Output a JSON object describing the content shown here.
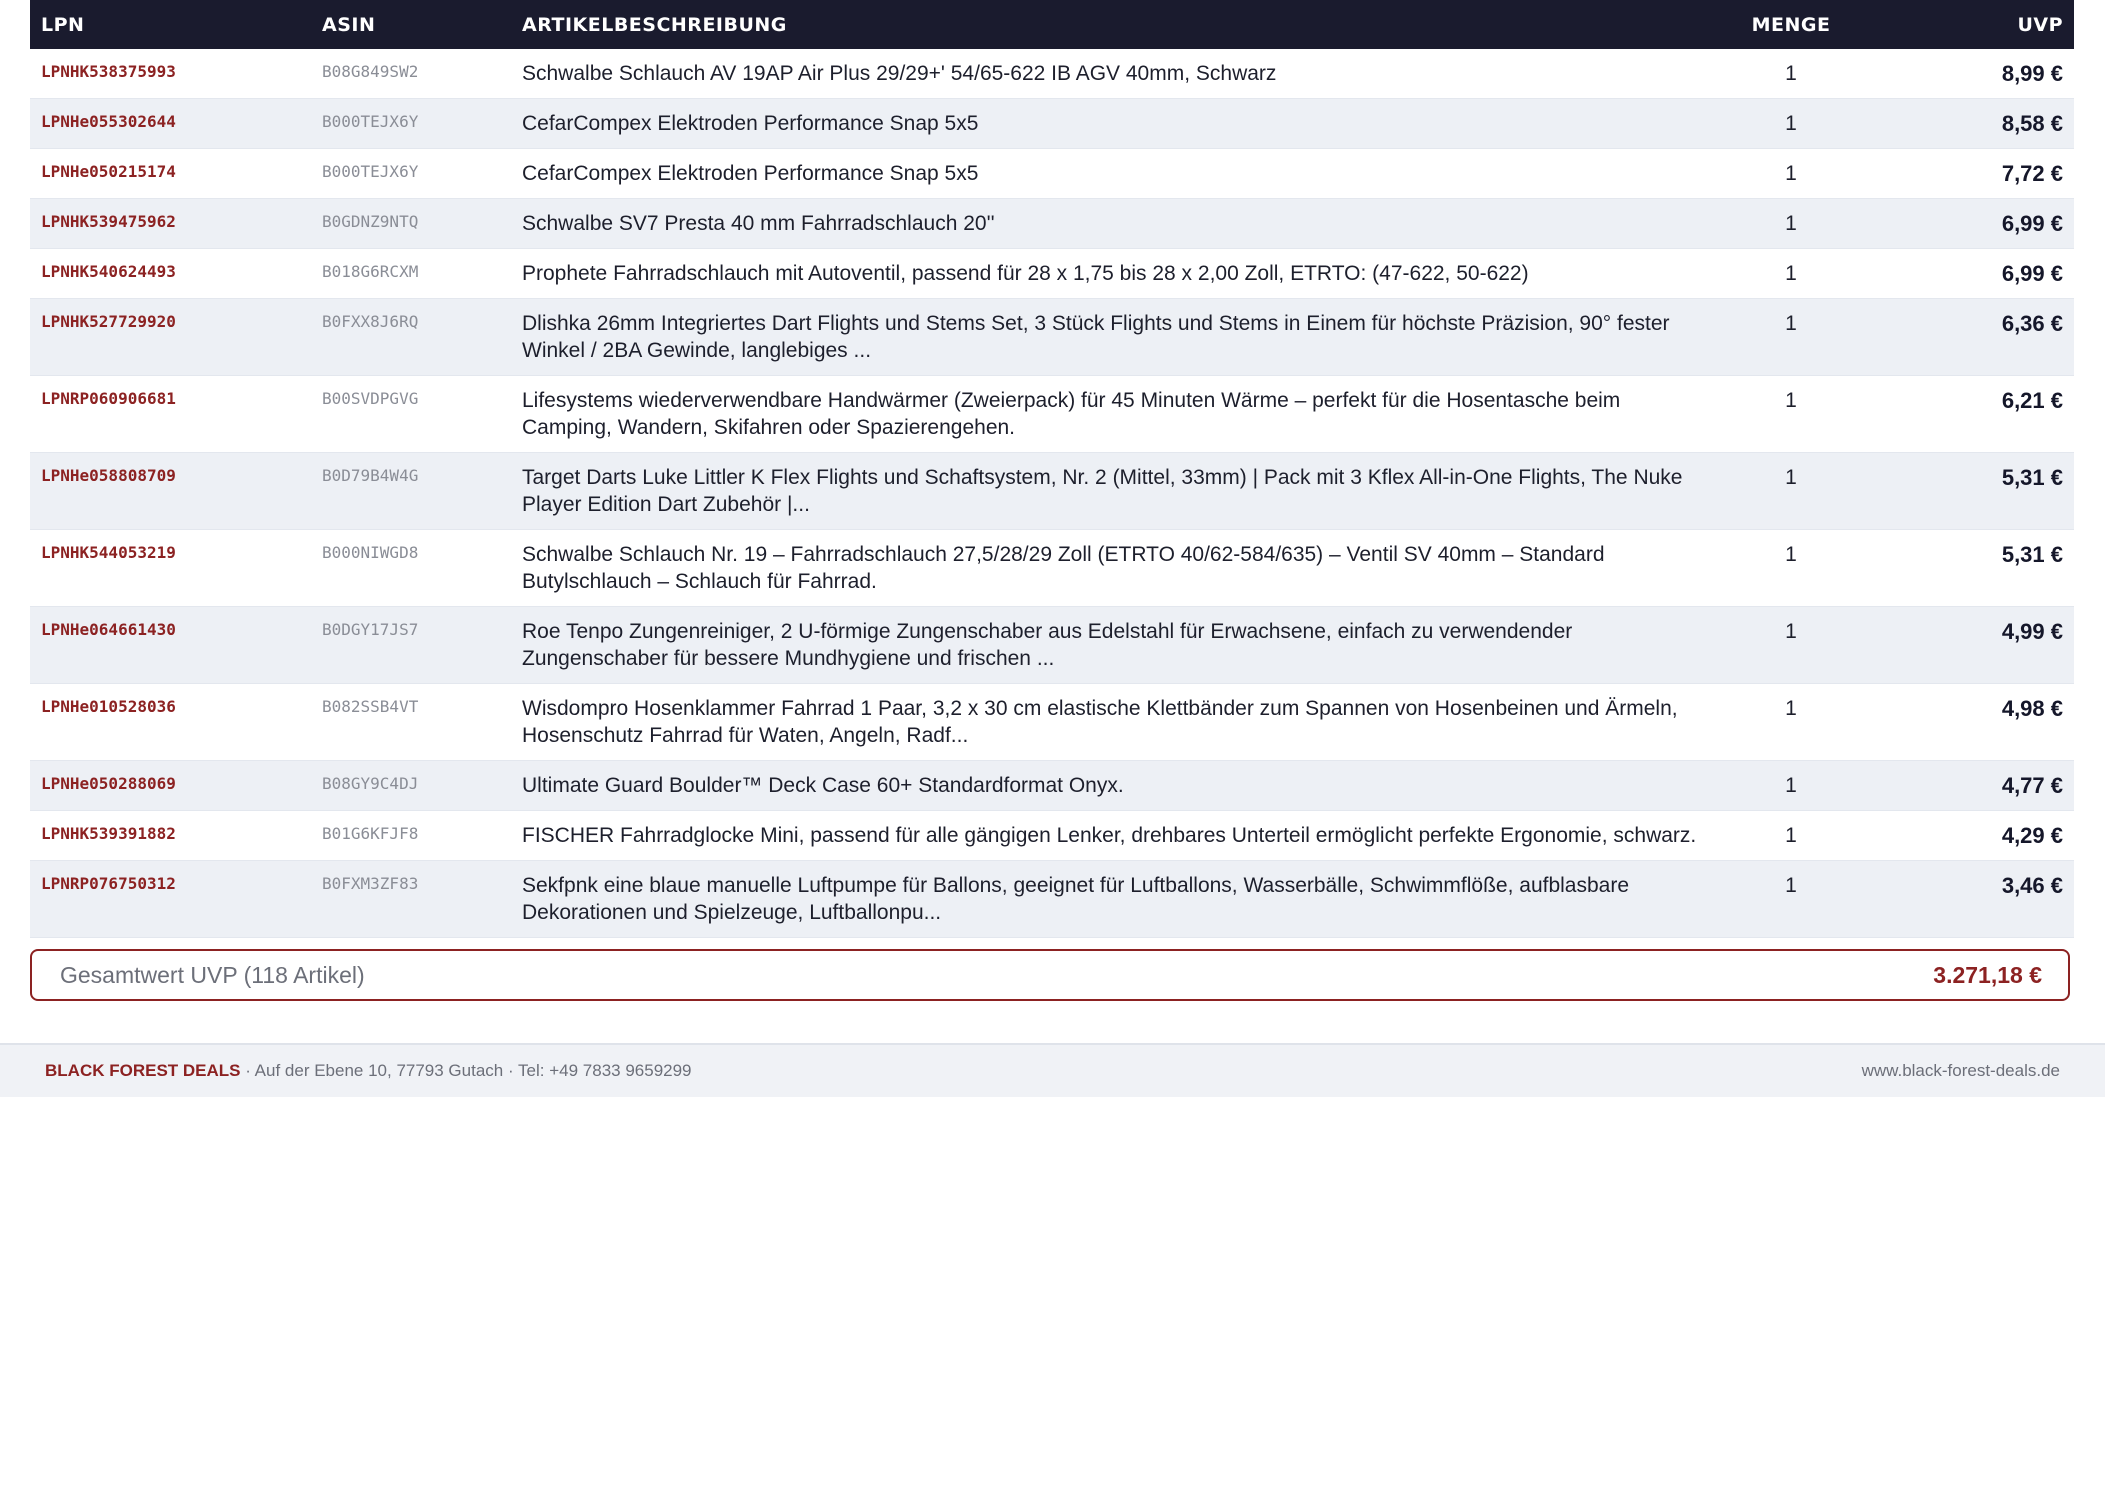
{
  "table": {
    "headers": {
      "lpn": "LPN",
      "asin": "ASIN",
      "description": "ARTIKELBESCHREIBUNG",
      "quantity": "MENGE",
      "uvp": "UVP"
    },
    "rows": [
      {
        "lpn": "LPNHK538375993",
        "asin": "B08G849SW2",
        "description": "Schwalbe Schlauch AV 19AP Air Plus 29/29+' 54/65-622 IB AGV 40mm, Schwarz",
        "quantity": "1",
        "uvp": "8,99 €"
      },
      {
        "lpn": "LPNHe055302644",
        "asin": "B000TEJX6Y",
        "description": "CefarCompex Elektroden Performance Snap 5x5",
        "quantity": "1",
        "uvp": "8,58 €"
      },
      {
        "lpn": "LPNHe050215174",
        "asin": "B000TEJX6Y",
        "description": "CefarCompex Elektroden Performance Snap 5x5",
        "quantity": "1",
        "uvp": "7,72 €"
      },
      {
        "lpn": "LPNHK539475962",
        "asin": "B0GDNZ9NTQ",
        "description": "Schwalbe SV7 Presta 40 mm Fahrradschlauch 20''",
        "quantity": "1",
        "uvp": "6,99 €"
      },
      {
        "lpn": "LPNHK540624493",
        "asin": "B018G6RCXM",
        "description": "Prophete Fahrradschlauch mit Autoventil, passend für 28 x 1,75 bis 28 x 2,00 Zoll, ETRTO: (47-622, 50-622)",
        "quantity": "1",
        "uvp": "6,99 €"
      },
      {
        "lpn": "LPNHK527729920",
        "asin": "B0FXX8J6RQ",
        "description": "Dlishka 26mm Integriertes Dart Flights und Stems Set, 3 Stück Flights und Stems in Einem für höchste Präzision, 90° fester Winkel / 2BA Gewinde, langlebiges ...",
        "quantity": "1",
        "uvp": "6,36 €"
      },
      {
        "lpn": "LPNRP060906681",
        "asin": "B00SVDPGVG",
        "description": "Lifesystems wiederverwendbare Handwärmer (Zweierpack) für 45 Minuten Wärme – perfekt für die Hosentasche beim Camping, Wandern, Skifahren oder Spazierengehen.",
        "quantity": "1",
        "uvp": "6,21 €"
      },
      {
        "lpn": "LPNHe058808709",
        "asin": "B0D79B4W4G",
        "description": "Target Darts Luke Littler K Flex Flights und Schaftsystem, Nr. 2 (Mittel, 33mm) | Pack mit 3 Kflex All-in-One Flights, The Nuke Player Edition Dart Zubehör |...",
        "quantity": "1",
        "uvp": "5,31 €"
      },
      {
        "lpn": "LPNHK544053219",
        "asin": "B000NIWGD8",
        "description": "Schwalbe Schlauch Nr. 19 – Fahrradschlauch 27,5/28/29 Zoll (ETRTO 40/62-584/635) – Ventil SV 40mm – Standard Butylschlauch – Schlauch für Fahrrad.",
        "quantity": "1",
        "uvp": "5,31 €"
      },
      {
        "lpn": "LPNHe064661430",
        "asin": "B0DGY17JS7",
        "description": "Roe Tenpo Zungenreiniger, 2 U-förmige Zungenschaber aus Edelstahl für Erwachsene, einfach zu verwendender Zungenschaber für bessere Mundhygiene und frischen ...",
        "quantity": "1",
        "uvp": "4,99 €"
      },
      {
        "lpn": "LPNHe010528036",
        "asin": "B082SSB4VT",
        "description": "Wisdompro Hosenklammer Fahrrad 1 Paar, 3,2 x 30 cm elastische Klettbänder zum Spannen von Hosenbeinen und Ärmeln, Hosenschutz Fahrrad für Waten, Angeln, Radf...",
        "quantity": "1",
        "uvp": "4,98 €"
      },
      {
        "lpn": "LPNHe050288069",
        "asin": "B08GY9C4DJ",
        "description": "Ultimate Guard Boulder™ Deck Case 60+ Standardformat Onyx.",
        "quantity": "1",
        "uvp": "4,77 €"
      },
      {
        "lpn": "LPNHK539391882",
        "asin": "B01G6KFJF8",
        "description": "FISCHER Fahrradglocke Mini, passend für alle gängigen Lenker, drehbares Unterteil ermöglicht perfekte Ergonomie, schwarz.",
        "quantity": "1",
        "uvp": "4,29 €"
      },
      {
        "lpn": "LPNRP076750312",
        "asin": "B0FXM3ZF83",
        "description": "Sekfpnk eine blaue manuelle Luftpumpe für Ballons, geeignet für Luftballons, Wasserbälle, Schwimmflöße, aufblasbare Dekorationen und Spielzeuge, Luftballonpu...",
        "quantity": "1",
        "uvp": "3,46 €"
      }
    ]
  },
  "total": {
    "label": "Gesamtwert UVP (118 Artikel)",
    "value": "3.271,18 €"
  },
  "footer": {
    "brand": "BLACK FOREST DEALS",
    "address": " · Auf der Ebene 10, 77793 Gutach · Tel: +49 7833 9659299",
    "website": "www.black-forest-deals.de"
  },
  "colors": {
    "header_bg": "#1a1b2e",
    "accent": "#8c2222",
    "row_alt": "#edf0f5"
  }
}
